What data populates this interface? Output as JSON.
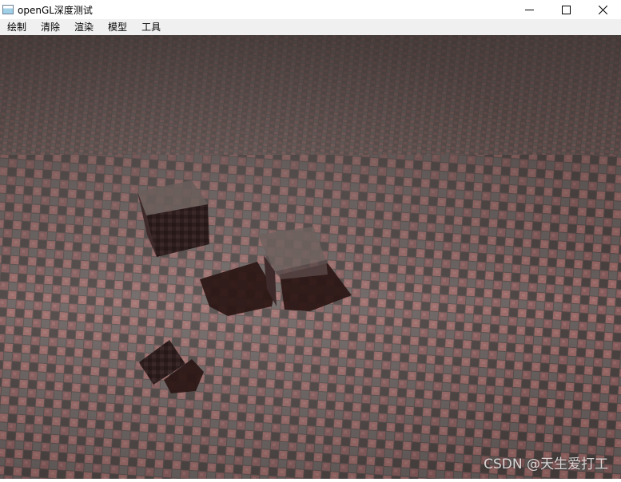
{
  "window": {
    "title": "openGL深度测试",
    "icon": "app-window-icon",
    "controls": [
      "minimize-icon",
      "maximize-icon",
      "close-icon"
    ]
  },
  "menu": {
    "items": [
      "绘制",
      "清除",
      "渲染",
      "模型",
      "工具"
    ]
  },
  "scene": {
    "floor_colors": [
      "#4a4240",
      "#86585a",
      "#5e5250",
      "#a0706e",
      "#3e3634"
    ],
    "cube_color": "#2e1e1e",
    "shadow_color": "#2a1614"
  },
  "watermark": "CSDN @天生爱打工"
}
